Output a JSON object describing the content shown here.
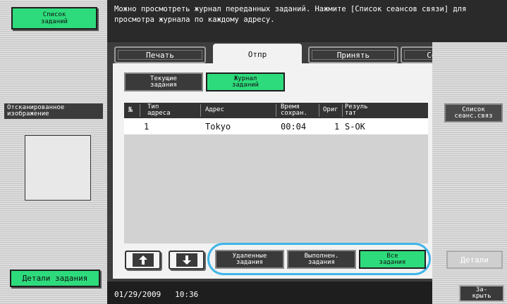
{
  "sidebar": {
    "job_list_label": "Список\nзаданий",
    "scan_label": "Отсканированное\nизображение",
    "job_details_label": "Детали задания"
  },
  "header": {
    "message": "Можно просмотреть журнал переданных заданий. Нажмите [Список сеансов связи] для просмотра журнала по каждому адресу."
  },
  "tabs": [
    {
      "label": "Печать",
      "active": false
    },
    {
      "label": "Отпр",
      "active": true
    },
    {
      "label": "Принять",
      "active": false
    },
    {
      "label": "Сохранить",
      "active": false
    }
  ],
  "subtabs": [
    {
      "label": "Текущие\nзадания",
      "active": false
    },
    {
      "label": "Журнал\nзаданий",
      "active": true
    }
  ],
  "table": {
    "headers": [
      "№",
      "Тип\nадреса",
      "Адрес",
      "Время\nсохран.",
      "Ориг",
      "Резуль\nтат"
    ],
    "rows": [
      {
        "no": "1",
        "type": "",
        "address": "Tokyo",
        "time": "00:04",
        "orig": "1",
        "result": "S-OK"
      }
    ]
  },
  "filters": [
    {
      "label": "Удаленные\nзадания",
      "active": false
    },
    {
      "label": "Выполнен.\nзадания",
      "active": false
    },
    {
      "label": "Все\nзадания",
      "active": true
    }
  ],
  "right": {
    "comm_list_label": "Список\nсеанс.связ",
    "details_label": "Детали",
    "close_label": "За-\nкрыть"
  },
  "status": {
    "date": "01/29/2009",
    "time": "10:36"
  },
  "colors": {
    "accent_green": "#2edb7c",
    "highlight_blue": "#3fb5e8"
  }
}
